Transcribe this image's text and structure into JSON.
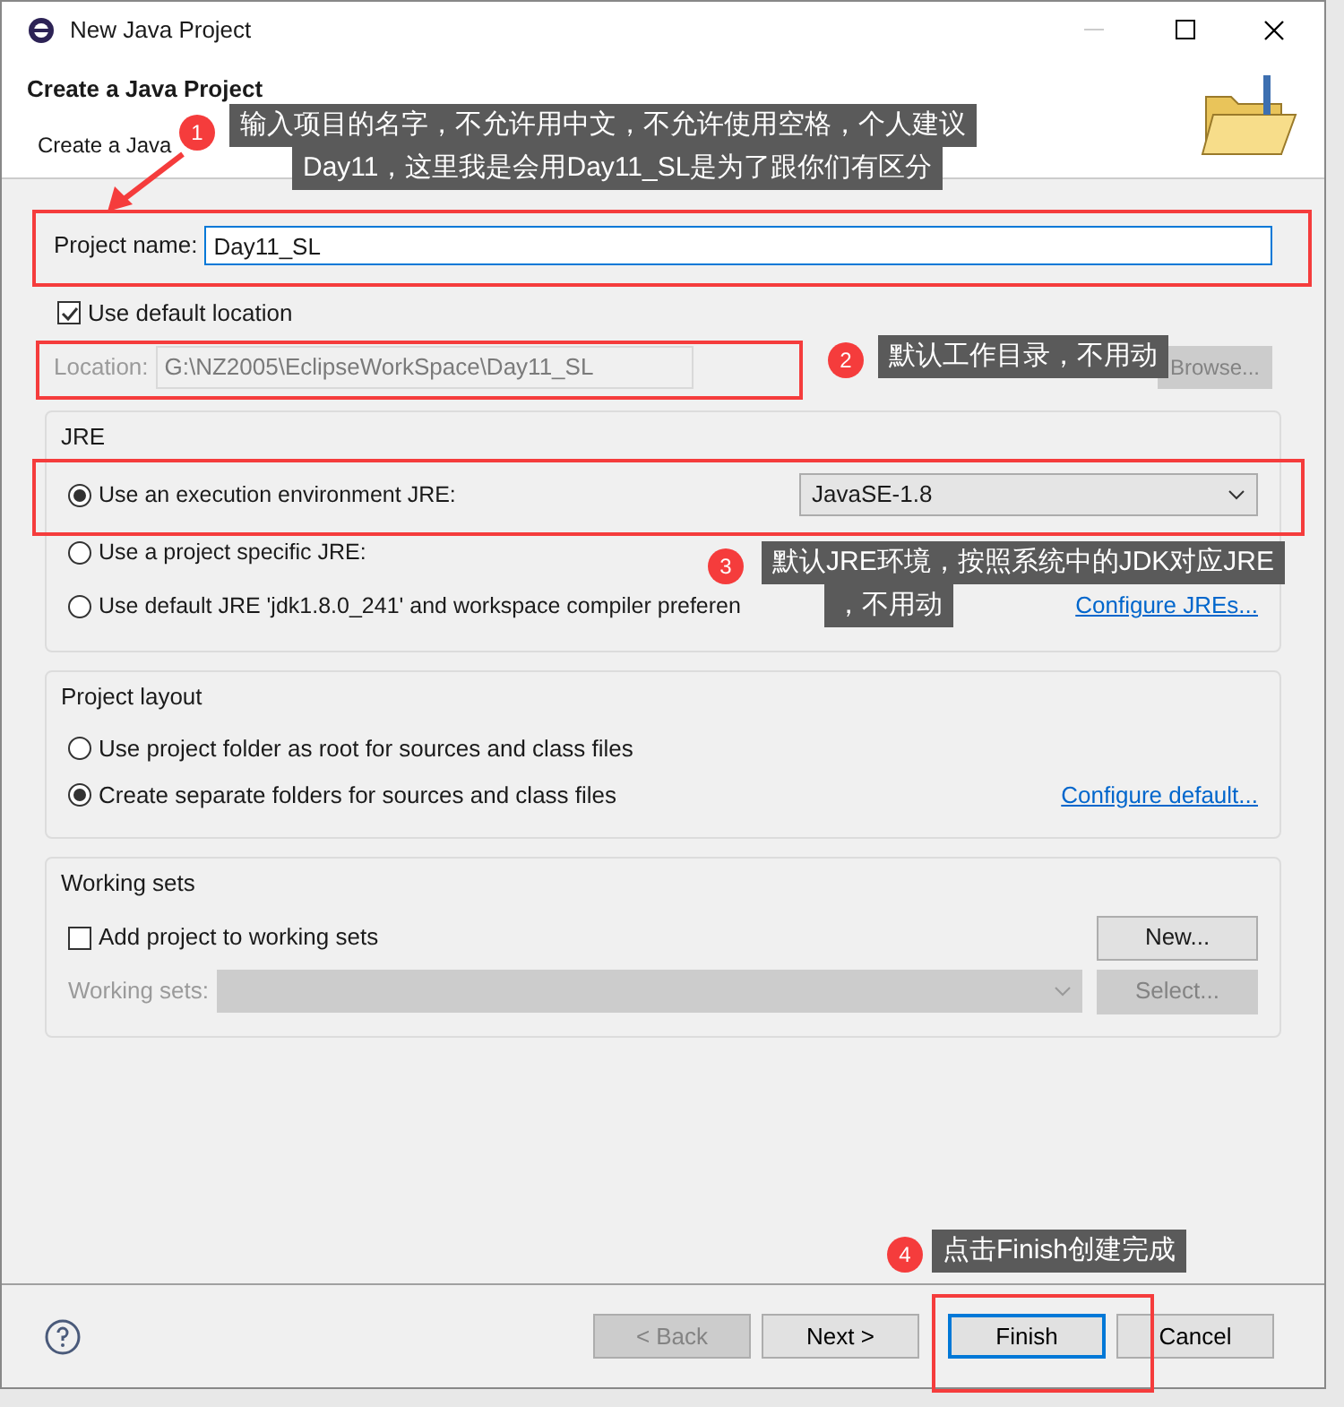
{
  "window": {
    "title": "New Java Project"
  },
  "header": {
    "title": "Create a Java Project",
    "subtitle": "Create a Java"
  },
  "project_name": {
    "label": "Project name:",
    "value": "Day11_SL"
  },
  "default_location": {
    "label": "Use default location",
    "checked": true
  },
  "location": {
    "label": "Location:",
    "value": "G:\\NZ2005\\EclipseWorkSpace\\Day11_SL",
    "disabled": true,
    "browse": "Browse..."
  },
  "jre": {
    "title": "JRE",
    "options": [
      {
        "label": "Use an execution environment JRE:",
        "selected": true,
        "combo": "JavaSE-1.8"
      },
      {
        "label": "Use a project specific JRE:",
        "selected": false
      },
      {
        "label": "Use default JRE 'jdk1.8.0_241' and workspace compiler preferen",
        "selected": false,
        "link": "Configure JREs..."
      }
    ]
  },
  "project_layout": {
    "title": "Project layout",
    "options": [
      {
        "label": "Use project folder as root for sources and class files",
        "selected": false
      },
      {
        "label": "Create separate folders for sources and class files",
        "selected": true,
        "link": "Configure default..."
      }
    ]
  },
  "working_sets": {
    "title": "Working sets",
    "add": {
      "label": "Add project to working sets",
      "checked": false
    },
    "new_button": "New...",
    "sets_label": "Working sets:",
    "select_button": "Select...",
    "disabled": true
  },
  "buttons": [
    {
      "label": "< Back",
      "disabled": true,
      "default": false
    },
    {
      "label": "Next >",
      "disabled": false,
      "default": false
    },
    {
      "label": "Finish",
      "disabled": false,
      "default": true
    },
    {
      "label": "Cancel",
      "disabled": false,
      "default": false
    }
  ],
  "annotations": [
    {
      "badge": "1",
      "lines": [
        "输入项目的名字，不允许用中文，不允许使用空格，个人建议",
        "Day11，这里我是会用Day11_SL是为了跟你们有区分"
      ]
    },
    {
      "badge": "2",
      "lines": [
        "默认工作目录，不用动"
      ]
    },
    {
      "badge": "3",
      "lines": [
        "默认JRE环境，按照系统中的JDK对应JRE",
        "，不用动"
      ]
    },
    {
      "badge": "4",
      "lines": [
        "点击Finish创建完成"
      ]
    }
  ]
}
